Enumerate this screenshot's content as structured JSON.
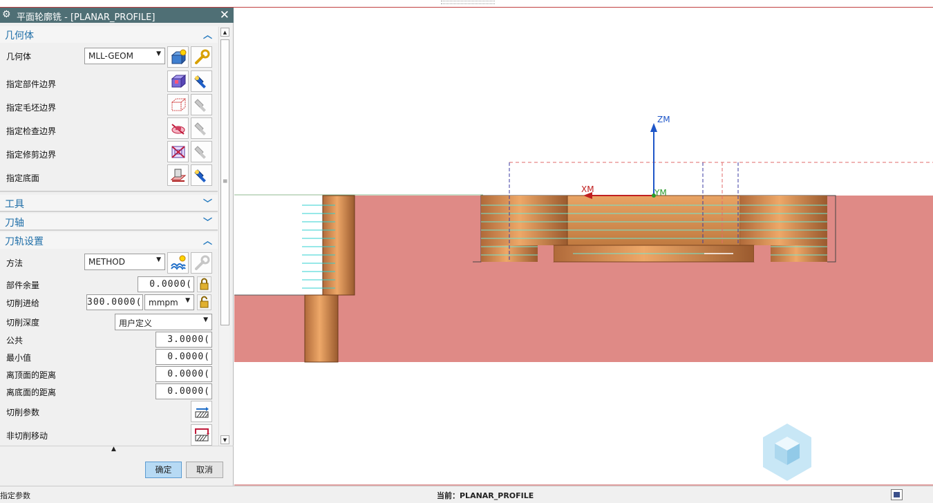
{
  "dialog": {
    "title": "平面轮廓铣 - [PLANAR_PROFILE]",
    "sections": {
      "geometry": "几何体",
      "tool": "工具",
      "tool_axis": "刀轴",
      "path_settings": "刀轨设置"
    },
    "geometry": {
      "label": "几何体",
      "value": "MLL-GEOM",
      "rows": [
        "指定部件边界",
        "指定毛坯边界",
        "指定检查边界",
        "指定修剪边界",
        "指定底面"
      ]
    },
    "path": {
      "method_label": "方法",
      "method_value": "METHOD",
      "part_stock_label": "部件余量",
      "part_stock_value": "0.0000(",
      "feed_label": "切削进给",
      "feed_value": "300.0000(",
      "feed_unit": "mmpm",
      "depth_label": "切削深度",
      "depth_value": "用户定义",
      "common_label": "公共",
      "common_value": "3.0000(",
      "min_label": "最小值",
      "min_value": "0.0000(",
      "top_offset_label": "离顶面的距离",
      "top_offset_value": "0.0000(",
      "bottom_offset_label": "离底面的距离",
      "bottom_offset_value": "0.0000(",
      "cut_params_label": "切削参数",
      "noncut_label": "非切削移动"
    },
    "ok_label": "确定",
    "cancel_label": "取消"
  },
  "viewport": {
    "axis_z": "ZM",
    "axis_x": "XM",
    "axis_y": "YM"
  },
  "status": {
    "left": "指定参数",
    "center": "当前：PLANAR_PROFILE"
  },
  "colors": {
    "stock": "#df8a86",
    "part": "#d98c4f",
    "title_bar": "#4f6f75",
    "section_text": "#1e6ea8",
    "ok_button": "#b7daf4"
  }
}
